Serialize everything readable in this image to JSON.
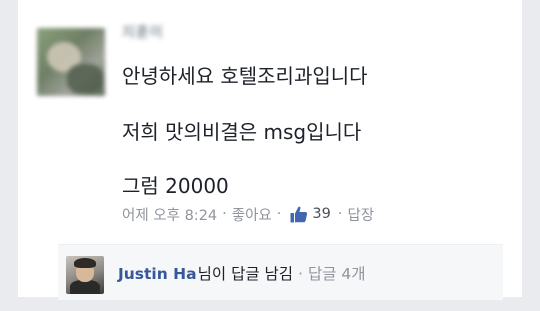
{
  "comment": {
    "username": "지훈이",
    "lines": [
      "안녕하세요 호텔조리과입니다",
      "저희 맛의비결은 msg입니다",
      "그럼 20000"
    ],
    "meta": {
      "time": "어제 오후 8:24",
      "like_label": "좋아요",
      "like_count": "39",
      "reply_label": "답장",
      "separator": "·",
      "like_icon": "thumbs-up-icon"
    }
  },
  "reply_summary": {
    "name": "Justin Ha",
    "action": "님이 답글 남김",
    "separator": "·",
    "count_label": "답글 4개"
  },
  "colors": {
    "link": "#365899",
    "meta_text": "#90949c",
    "body_text": "#1d2129",
    "reply_bg": "#f6f7f9",
    "page_bg": "#e9ebee"
  }
}
